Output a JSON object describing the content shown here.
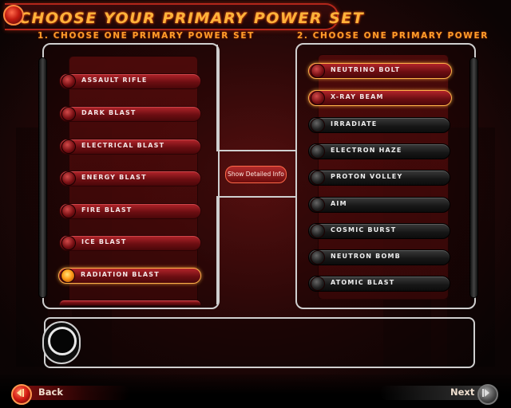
{
  "title": "CHOOSE YOUR PRIMARY POWER SET",
  "left_column": {
    "header": "1. CHOOSE ONE PRIMARY POWER SET",
    "items": [
      {
        "label": "ASSAULT RIFLE",
        "selected": false
      },
      {
        "label": "DARK BLAST",
        "selected": false
      },
      {
        "label": "ELECTRICAL BLAST",
        "selected": false
      },
      {
        "label": "ENERGY BLAST",
        "selected": false
      },
      {
        "label": "FIRE BLAST",
        "selected": false
      },
      {
        "label": "ICE BLAST",
        "selected": false
      },
      {
        "label": "RADIATION BLAST",
        "selected": true
      }
    ]
  },
  "right_column": {
    "header": "2. CHOOSE ONE PRIMARY POWER",
    "items": [
      {
        "label": "NEUTRINO BOLT",
        "state": "selected"
      },
      {
        "label": "X-RAY BEAM",
        "state": "available"
      },
      {
        "label": "IRRADIATE",
        "state": "locked"
      },
      {
        "label": "ELECTRON HAZE",
        "state": "locked"
      },
      {
        "label": "PROTON VOLLEY",
        "state": "locked"
      },
      {
        "label": "AIM",
        "state": "locked"
      },
      {
        "label": "COSMIC BURST",
        "state": "locked"
      },
      {
        "label": "NEUTRON BOMB",
        "state": "locked"
      },
      {
        "label": "ATOMIC BLAST",
        "state": "locked"
      }
    ]
  },
  "detail_button": "Show Detailed Info",
  "footer": {
    "back_label": "Back",
    "next_label": "Next"
  },
  "colors": {
    "accent_orange": "#ff9d2a",
    "pill_red": "#8a1418",
    "pill_dark": "#1c1c1c"
  }
}
